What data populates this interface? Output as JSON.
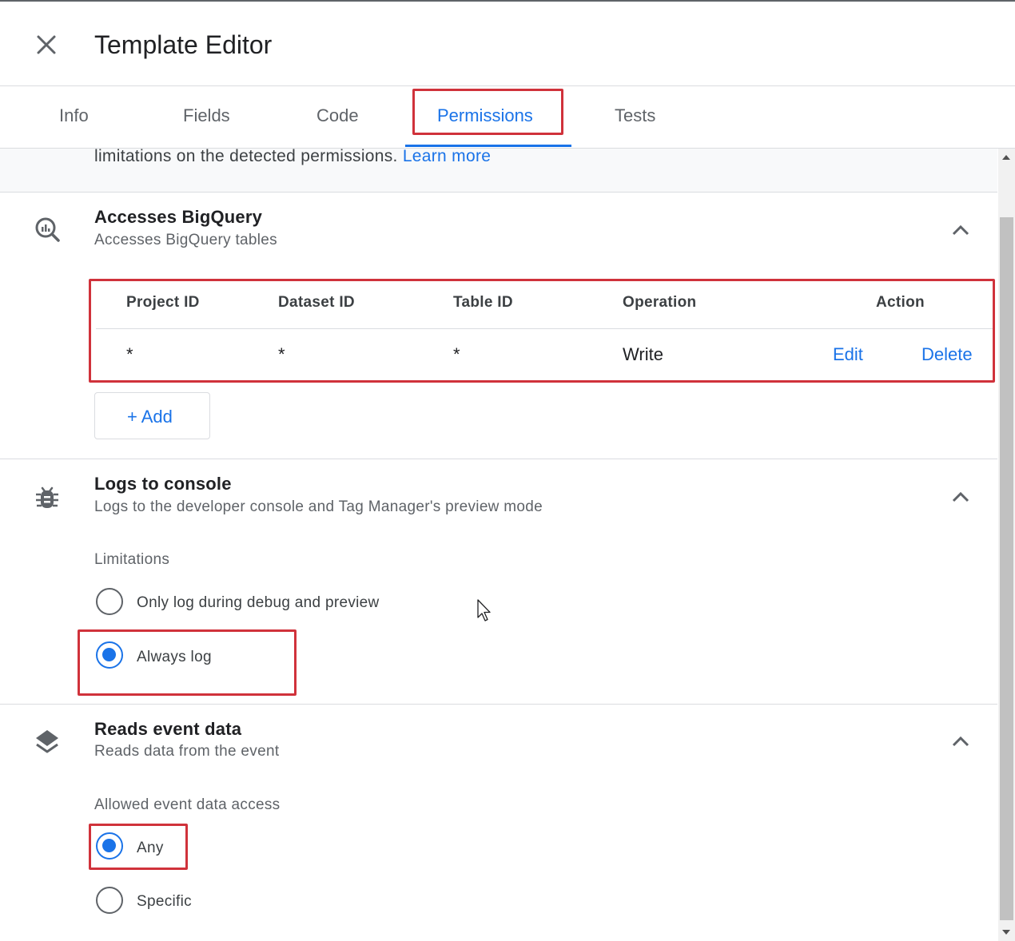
{
  "header": {
    "title": "Template Editor"
  },
  "tabs": [
    {
      "label": "Info"
    },
    {
      "label": "Fields"
    },
    {
      "label": "Code"
    },
    {
      "label": "Permissions",
      "active": true
    },
    {
      "label": "Tests"
    }
  ],
  "notice": {
    "text": "limitations on the detected permissions. ",
    "link": "Learn more"
  },
  "sections": {
    "bigquery": {
      "title": "Accesses BigQuery",
      "subtitle": "Accesses BigQuery tables",
      "table": {
        "headers": [
          "Project ID",
          "Dataset ID",
          "Table ID",
          "Operation",
          "Action"
        ],
        "rows": [
          {
            "project": "*",
            "dataset": "*",
            "table": "*",
            "operation": "Write",
            "edit": "Edit",
            "delete": "Delete"
          }
        ]
      },
      "add_label": "+ Add"
    },
    "console": {
      "title": "Logs to console",
      "subtitle": "Logs to the developer console and Tag Manager's preview mode",
      "limitations_label": "Limitations",
      "options": [
        {
          "label": "Only log during debug and preview",
          "checked": false
        },
        {
          "label": "Always log",
          "checked": true
        }
      ]
    },
    "event": {
      "title": "Reads event data",
      "subtitle": "Reads data from the event",
      "access_label": "Allowed event data access",
      "options": [
        {
          "label": "Any",
          "checked": true
        },
        {
          "label": "Specific",
          "checked": false
        }
      ]
    }
  },
  "colors": {
    "accent": "#1a73e8",
    "highlight": "#d0323b"
  }
}
